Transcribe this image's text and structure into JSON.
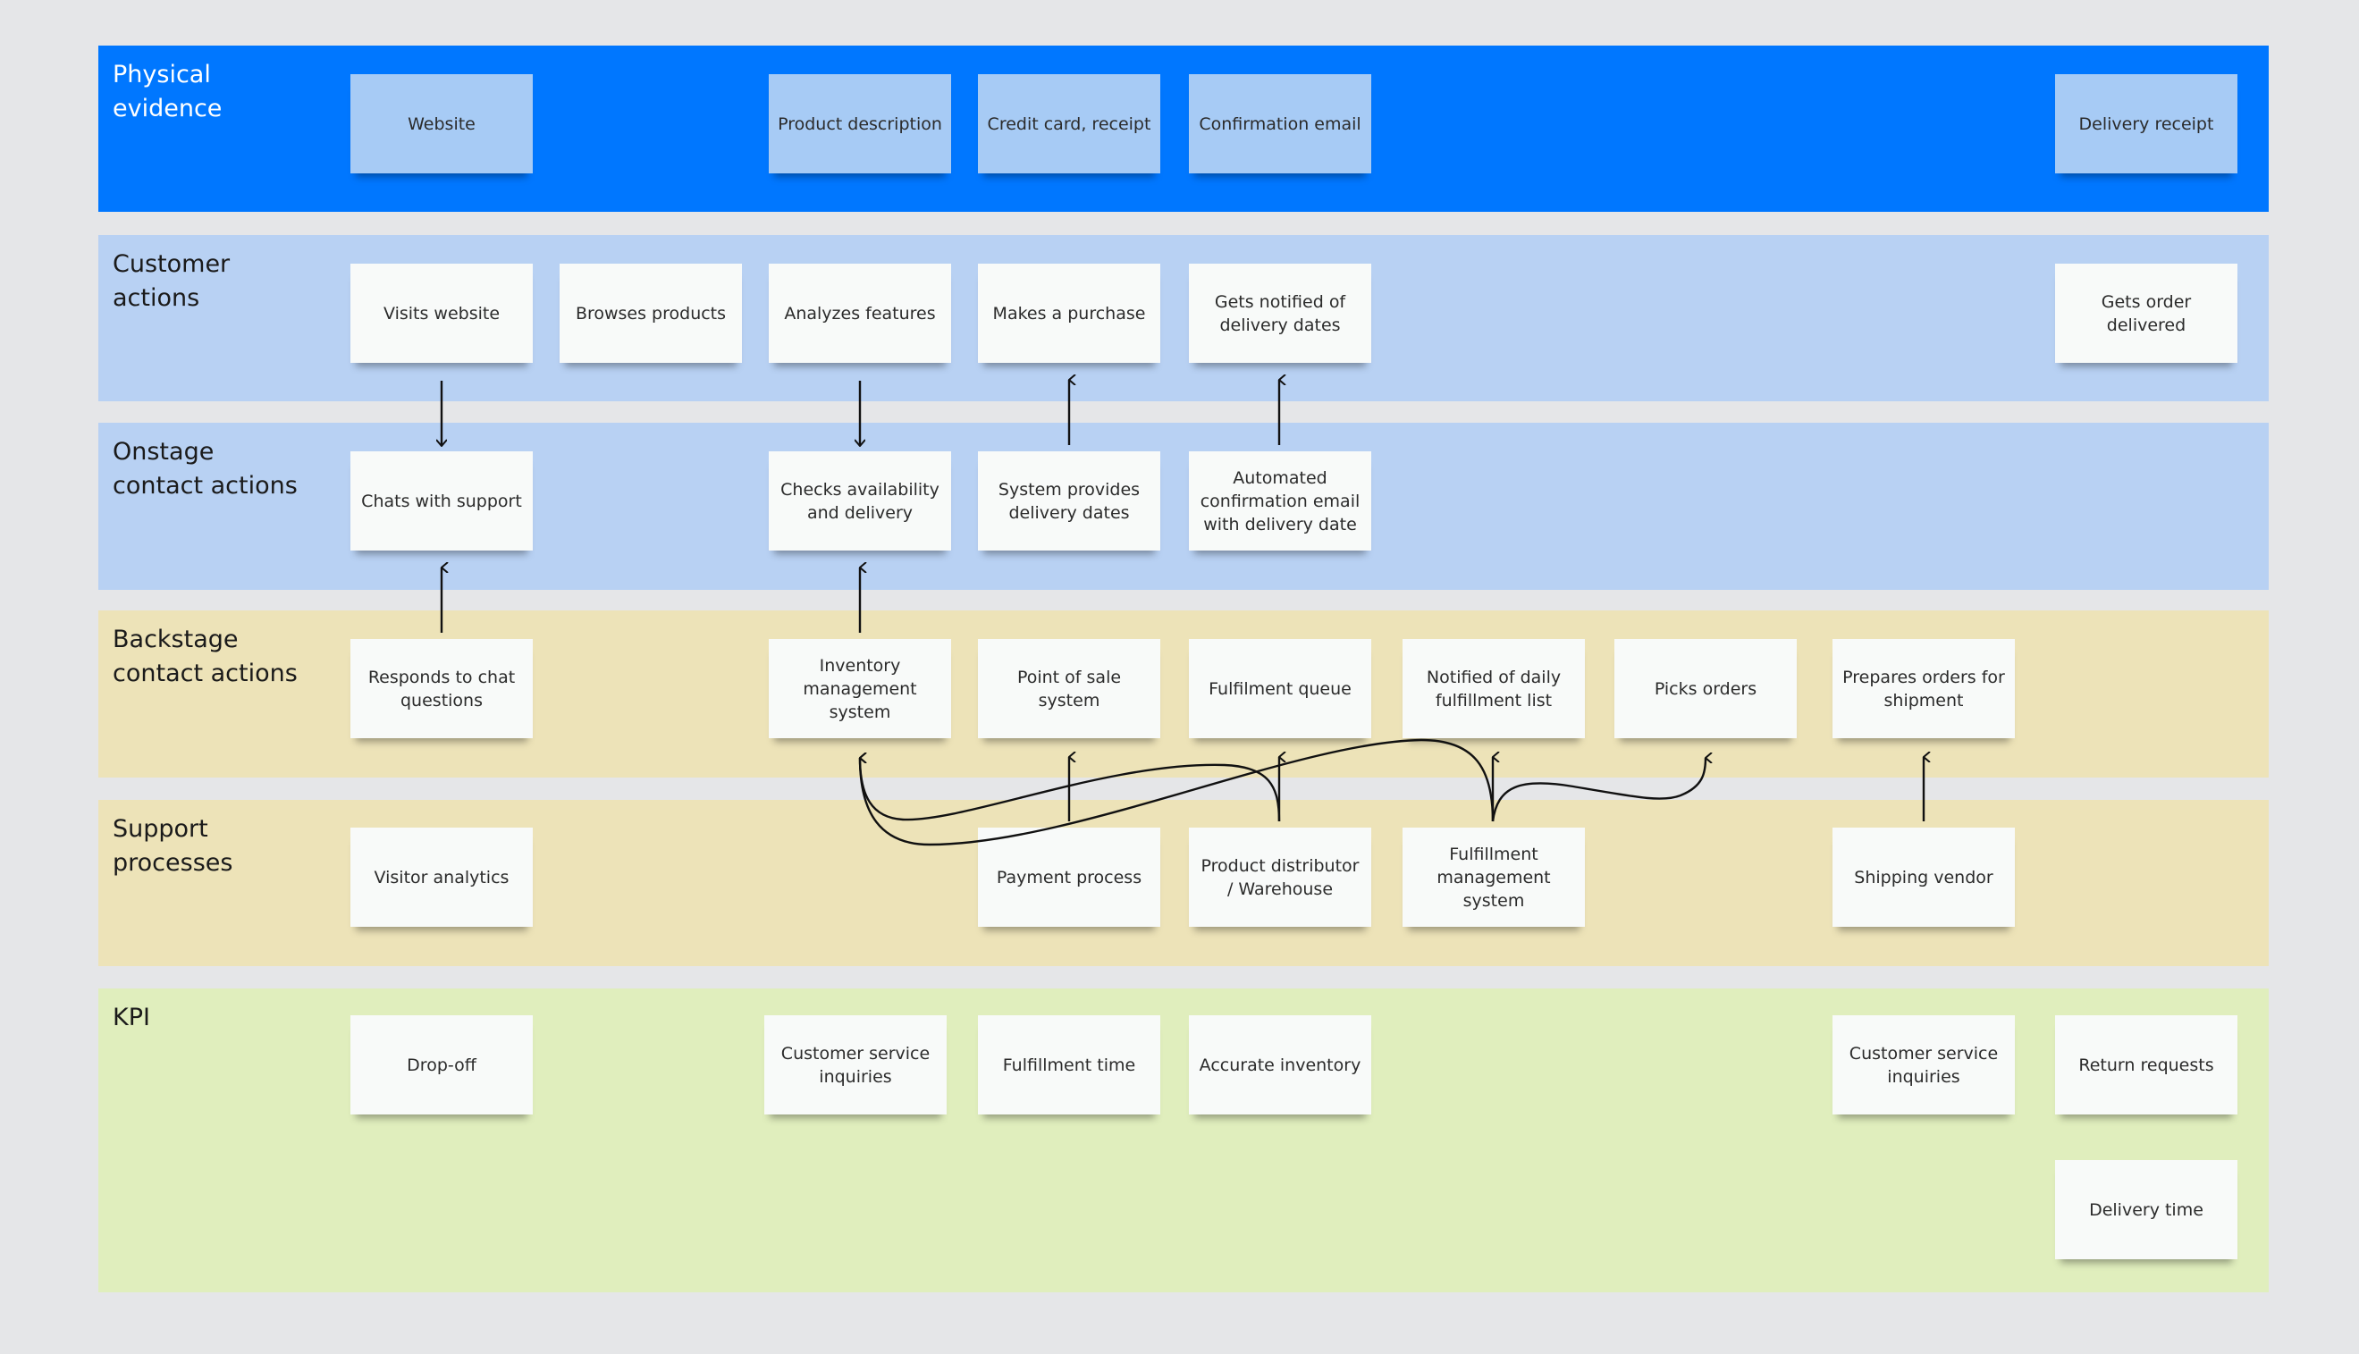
{
  "lanes": [
    {
      "id": "physical-evidence",
      "title": "Physical\nevidence",
      "color": "#0077ff"
    },
    {
      "id": "customer-actions",
      "title": "Customer\nactions",
      "color": "#b8d1f3"
    },
    {
      "id": "onstage-contact-actions",
      "title": "Onstage\ncontact actions",
      "color": "#b8d1f3"
    },
    {
      "id": "backstage-contact-actions",
      "title": "Backstage\ncontact actions",
      "color": "#ede3b8"
    },
    {
      "id": "support-processes",
      "title": "Support\nprocesses",
      "color": "#ede3b8"
    },
    {
      "id": "kpi",
      "title": "KPI",
      "color": "#e0eebd"
    }
  ],
  "stickies": {
    "physical_evidence": [
      "Website",
      "Product description",
      "Credit card, receipt",
      "Confirmation email",
      "Delivery receipt"
    ],
    "customer_actions": [
      "Visits website",
      "Browses products",
      "Analyzes features",
      "Makes a purchase",
      "Gets notified of delivery dates",
      "Gets order delivered"
    ],
    "onstage": [
      "Chats with support",
      "Checks availability and delivery",
      "System provides delivery dates",
      "Automated confirmation email with delivery date"
    ],
    "backstage": [
      "Responds to chat questions",
      "Inventory management system",
      "Point of sale system",
      "Fulfilment queue",
      "Notified of daily fulfillment list",
      "Picks orders",
      "Prepares orders for shipment"
    ],
    "support": [
      "Visitor analytics",
      "Payment process",
      "Product distributor / Warehouse",
      "Fulfillment management system",
      "Shipping vendor"
    ],
    "kpi": [
      "Drop-off",
      "Customer service inquiries",
      "Fulfillment time",
      "Accurate inventory",
      "Customer service inquiries",
      "Return requests",
      "Delivery time"
    ]
  },
  "colors": {
    "background": "#e5e6e8",
    "evidence_sticky": "#a7cbf5",
    "sticky": "#f8faf9",
    "connector": "#111111"
  }
}
